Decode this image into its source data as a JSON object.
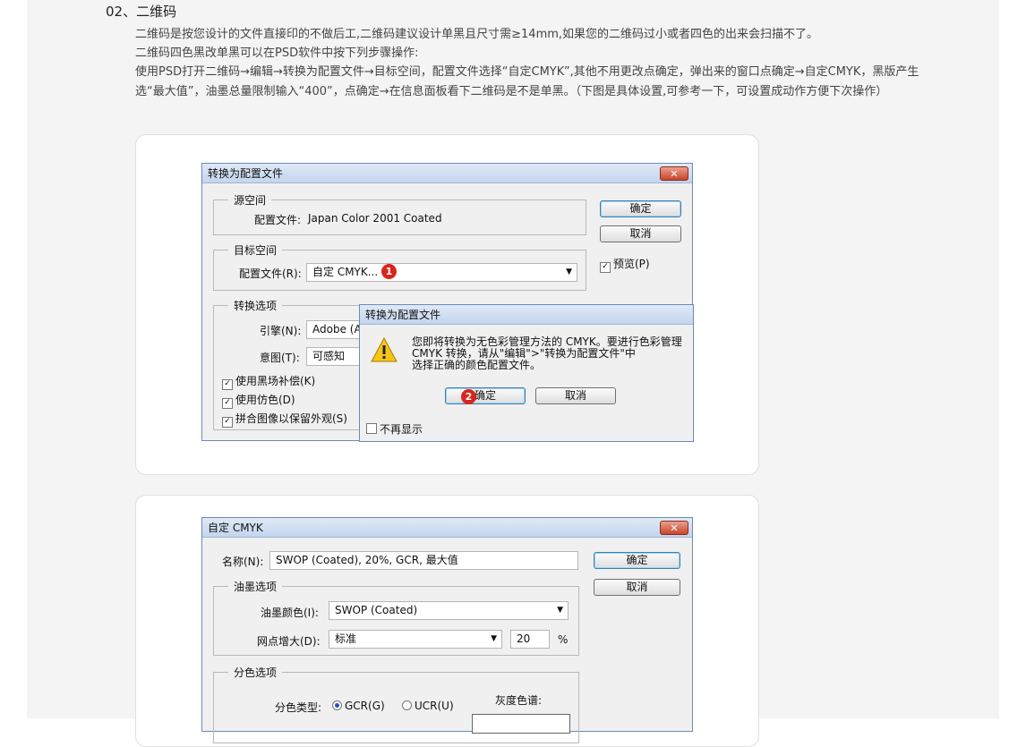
{
  "section": {
    "heading": "02、二维码",
    "para1": "二维码是按您设计的文件直接印的不做后工,二维码建议设计单黑且尺寸需≥14mm,如果您的二维码过小或者四色的出来会扫描不了。",
    "para2": "二维码四色黑改单黑可以在PSD软件中按下列步骤操作:",
    "para3": "使用PSD打开二维码→编辑→转换为配置文件→目标空间，配置文件选择“自定CMYK”,其他不用更改点确定，弹出来的窗口点确定→自定CMYK，黑版产生选“最大值”，油墨总量限制输入“400”，点确定→在信息面板看下二维码是不是单黑。（下图是具体设置,可参考一下，可设置成动作方便下次操作）"
  },
  "dialog1": {
    "title": "转换为配置文件",
    "close": "✕",
    "source_legend": "源空间",
    "source_profile_label": "配置文件:",
    "source_profile_value": "Japan Color 2001 Coated",
    "target_legend": "目标空间",
    "target_profile_label": "配置文件(R):",
    "target_profile_value": "自定 CMYK...",
    "badge1": "1",
    "ok": "确定",
    "cancel": "取消",
    "preview": "预览(P)",
    "convert_legend": "转换选项",
    "engine_label": "引擎(N):",
    "engine_value": "Adobe (A",
    "intent_label": "意图(T):",
    "intent_value": "可感知",
    "opt_bpc": "使用黑场补偿(K)",
    "opt_dither": "使用仿色(D)",
    "opt_flatten": "拼合图像以保留外观(S)"
  },
  "alert": {
    "title": "转换为配置文件",
    "line1": "您即将转换为无色彩管理方法的 CMYK。要进行色彩管理",
    "line2": "CMYK 转换，请从\"编辑\">\"转换为配置文件\"中",
    "line3": "选择正确的颜色配置文件。",
    "badge2": "2",
    "ok": "确定",
    "cancel": "取消",
    "dont_show": "不再显示"
  },
  "dialog2": {
    "title": "自定 CMYK",
    "close": "✕",
    "name_label": "名称(N):",
    "name_value": "SWOP (Coated), 20%, GCR, 最大值",
    "ok": "确定",
    "cancel": "取消",
    "ink_legend": "油墨选项",
    "ink_colors_label": "油墨颜色(I):",
    "ink_colors_value": "SWOP (Coated)",
    "dot_gain_label": "网点增大(D):",
    "dot_gain_value": "标准",
    "dot_gain_pct": "20",
    "pct_sign": "%",
    "separation_legend": "分色选项",
    "sep_type_label": "分色类型:",
    "gcr": "GCR(G)",
    "ucr": "UCR(U)",
    "gray_ramp": "灰度色谱:"
  },
  "colors": {
    "title_grad_top": "#dfe9f6",
    "badge": "#d9251c",
    "accent": "#3c7fb1"
  }
}
